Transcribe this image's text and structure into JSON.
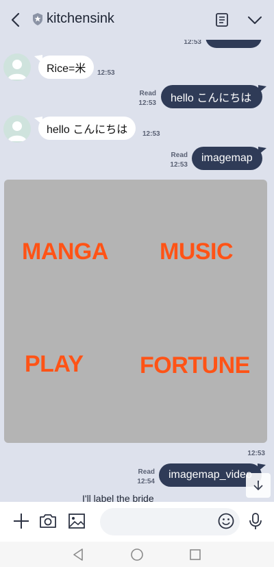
{
  "header": {
    "title": "kitchensink",
    "back_icon": "back-chevron-icon",
    "official_icon": "shield-star-icon",
    "notes_icon": "notes-icon",
    "menu_icon": "chevron-down-icon"
  },
  "messages": {
    "top_partial_time": "12:53",
    "m1": {
      "text": "Rice=米",
      "time": "12:53"
    },
    "m2": {
      "read": "Read",
      "time": "12:53",
      "text": "hello こんにちは"
    },
    "m3": {
      "text": "hello こんにちは",
      "time": "12:53"
    },
    "m4": {
      "read": "Read",
      "time": "12:53",
      "text": "imagemap"
    },
    "imagemap": {
      "labels": [
        "MANGA",
        "MUSIC",
        "PLAY",
        "FORTUNE"
      ],
      "label_color": "#ff5316",
      "background": "#b4b4b4"
    },
    "imagemap_time": "12:53",
    "m5": {
      "read": "Read",
      "time": "12:54",
      "text": "imagemap_video"
    },
    "partial_text": "I'll label the bride"
  },
  "input_bar": {
    "plus_icon": "plus-icon",
    "camera_icon": "camera-icon",
    "image_icon": "image-icon",
    "emoji_icon": "emoji-icon",
    "mic_icon": "mic-icon",
    "placeholder": ""
  },
  "nav": {
    "back": "triangle-back-icon",
    "home": "circle-home-icon",
    "recents": "square-recents-icon"
  },
  "colors": {
    "background": "#dde1ec",
    "bubble_out": "#2f3b57",
    "bubble_in": "#ffffff",
    "accent_orange": "#ff5316"
  }
}
